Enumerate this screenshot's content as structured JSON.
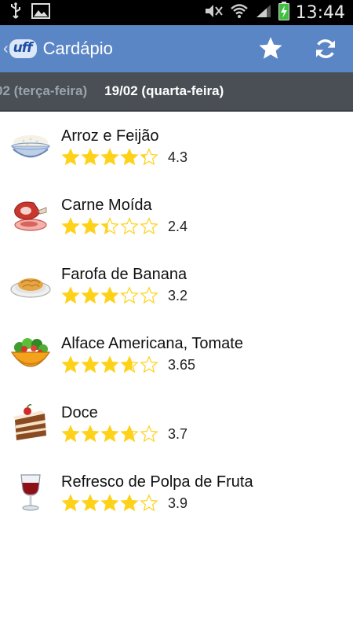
{
  "status_bar": {
    "time": "13:44",
    "icons": [
      "usb-icon",
      "image-icon",
      "mute-icon",
      "wifi-icon",
      "signal-icon",
      "battery-charging-icon"
    ]
  },
  "action_bar": {
    "title": "Cardápio",
    "logo_text": "uff",
    "actions": [
      "star-icon",
      "refresh-icon"
    ],
    "colors": {
      "background": "#5b86c6",
      "logo": "#1e4ea3"
    }
  },
  "tabs": [
    {
      "label": "02 (terça-feira)",
      "active": false
    },
    {
      "label": "19/02 (quarta-feira)",
      "active": true
    }
  ],
  "menu": {
    "star_color": "#ffd21a",
    "items": [
      {
        "name": "Arroz e Feijão",
        "rating": 4.3,
        "rating_label": "4.3",
        "icon": "rice-bowl-icon"
      },
      {
        "name": "Carne Moída",
        "rating": 2.4,
        "rating_label": "2.4",
        "icon": "ham-icon"
      },
      {
        "name": "Farofa de Banana",
        "rating": 3.2,
        "rating_label": "3.2",
        "icon": "farofa-plate-icon"
      },
      {
        "name": "Alface Americana, Tomate",
        "rating": 3.65,
        "rating_label": "3.65",
        "icon": "salad-bowl-icon"
      },
      {
        "name": "Doce",
        "rating": 3.7,
        "rating_label": "3.7",
        "icon": "cake-icon"
      },
      {
        "name": "Refresco de Polpa de Fruta",
        "rating": 3.9,
        "rating_label": "3.9",
        "icon": "wine-glass-icon"
      }
    ]
  }
}
